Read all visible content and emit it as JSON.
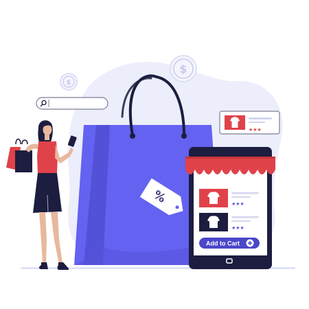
{
  "colors": {
    "primary": "#6462f0",
    "primary_dark": "#4a47c9",
    "accent_red": "#e0424a",
    "dark_navy": "#1c1d3f",
    "blob": "#eceefb",
    "star": "#5a58d6"
  },
  "coins": {
    "large": {
      "symbol": "$",
      "icon": "dollar-coin-icon"
    },
    "small": {
      "symbol": "$",
      "icon": "dollar-coin-icon"
    }
  },
  "search_bar": {
    "value": "",
    "icon": "search-icon"
  },
  "bag": {
    "tag_text": "%",
    "icon": "percent-tag-icon"
  },
  "floating_card": {
    "icon": "tshirt-icon",
    "rating_stars": "★★★"
  },
  "phone_app": {
    "products": [
      {
        "icon": "tshirt-icon",
        "color": "#e0424a",
        "rating_stars": "★★★"
      },
      {
        "icon": "tshirt-icon",
        "color": "#1c1d3f",
        "rating_stars": "★★★"
      }
    ],
    "cart_button_label": "Add to Cart",
    "cart_button_icon": "plus-circle-icon"
  }
}
